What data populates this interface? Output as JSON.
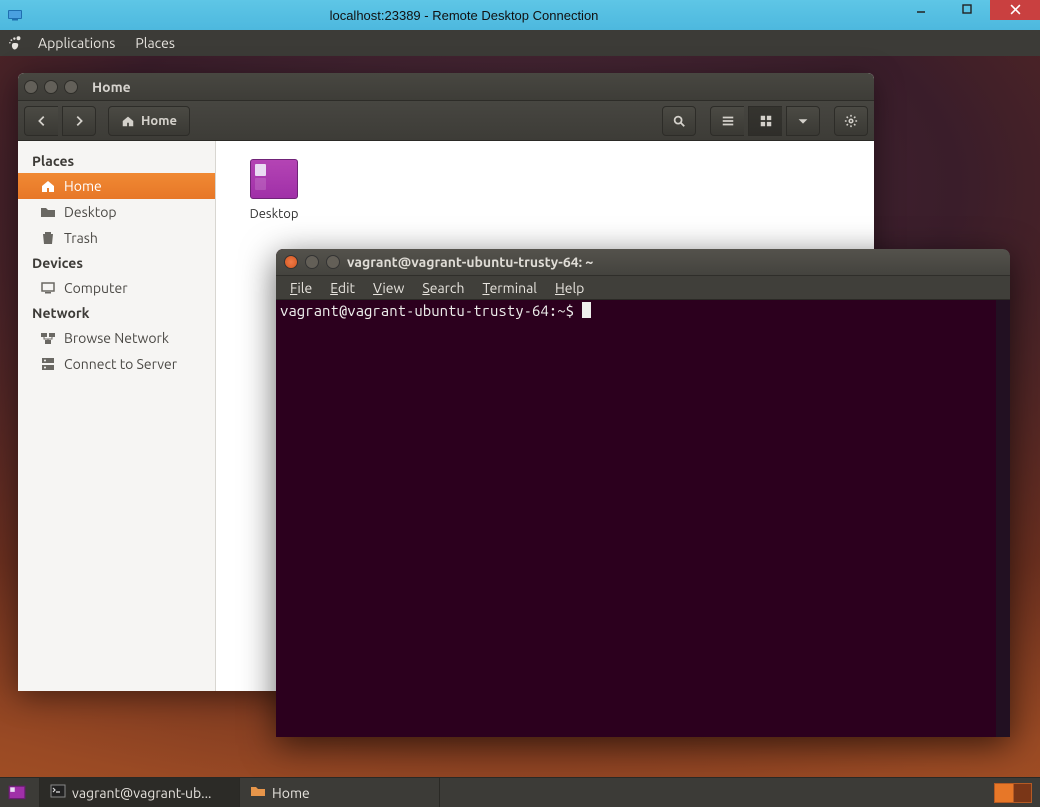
{
  "rdp": {
    "title": "localhost:23389 - Remote Desktop Connection"
  },
  "gnome": {
    "menu_applications": "Applications",
    "menu_places": "Places"
  },
  "nautilus": {
    "window_title": "Home",
    "breadcrumb_home": "Home",
    "sidebar": {
      "heading_places": "Places",
      "item_home": "Home",
      "item_desktop": "Desktop",
      "item_trash": "Trash",
      "heading_devices": "Devices",
      "item_computer": "Computer",
      "heading_network": "Network",
      "item_browse_network": "Browse Network",
      "item_connect_server": "Connect to Server"
    },
    "files": {
      "desktop_label": "Desktop"
    }
  },
  "terminal": {
    "window_title": "vagrant@vagrant-ubuntu-trusty-64: ~",
    "menus": {
      "file": "File",
      "edit": "Edit",
      "view": "View",
      "search": "Search",
      "terminal": "Terminal",
      "help": "Help"
    },
    "prompt": "vagrant@vagrant-ubuntu-trusty-64:~$ "
  },
  "panel": {
    "task_terminal": "vagrant@vagrant-ub...",
    "task_home": "Home"
  }
}
